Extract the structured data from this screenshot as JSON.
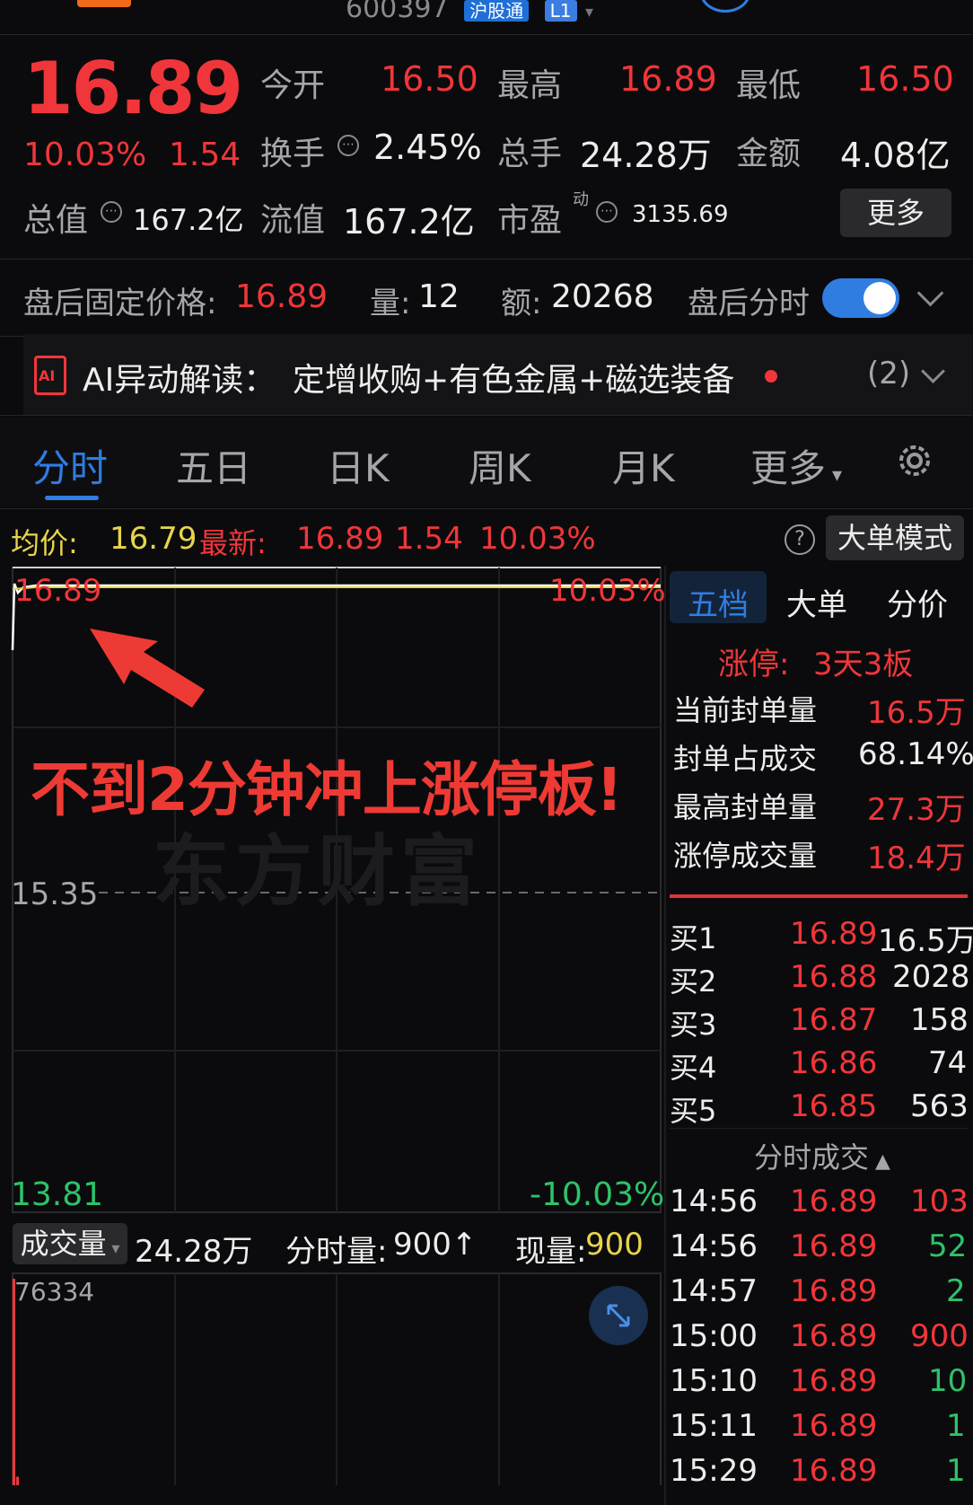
{
  "header": {
    "code": "600397",
    "badges": [
      "沪股通",
      "L1"
    ]
  },
  "quote": {
    "price": "16.89",
    "pct": "10.03%",
    "change": "1.54",
    "row1": [
      {
        "label": "今开",
        "value": "16.50"
      },
      {
        "label": "最高",
        "value": "16.89"
      },
      {
        "label": "最低",
        "value": "16.50"
      }
    ],
    "row2": [
      {
        "label": "换手",
        "value": "2.45%"
      },
      {
        "label": "总手",
        "value": "24.28万"
      },
      {
        "label": "金额",
        "value": "4.08亿"
      }
    ],
    "row3": [
      {
        "label": "总值",
        "value": "167.2亿"
      },
      {
        "label": "流值",
        "value": "167.2亿"
      },
      {
        "label": "市盈",
        "sup": "动",
        "value": "3135.69"
      }
    ],
    "more": "更多"
  },
  "after_hours": {
    "price_label": "盘后固定价格:",
    "price": "16.89",
    "vol_label": "量:",
    "vol": "12",
    "amt_label": "额:",
    "amt": "20268",
    "toggle_label": "盘后分时",
    "toggle_on": true
  },
  "ai": {
    "label": "AI异动解读：",
    "text": "定增收购+有色金属+磁选装备",
    "count": "(2)"
  },
  "tabs": [
    "分时",
    "五日",
    "日K",
    "周K",
    "月K",
    "更多"
  ],
  "active_tab": 0,
  "infobar": {
    "avg_label": "均价:",
    "avg": "16.79",
    "latest_label": "最新:",
    "latest": "16.89",
    "change": "1.54",
    "pct": "10.03%",
    "mode": "大单模式"
  },
  "chart": {
    "top_price": "16.89",
    "top_pct": "10.03%",
    "mid_price": "15.35",
    "bottom_price": "13.81",
    "bottom_pct": "-10.03%",
    "annotation": "不到2分钟冲上涨停板!",
    "watermark": "东方财富"
  },
  "volume_bar": {
    "label": "成交量",
    "total": "24.28万",
    "period_label": "分时量:",
    "period": "900↑",
    "current_label": "现量:",
    "current": "900",
    "max": "76334"
  },
  "volume_data": [
    76334,
    9000,
    2100,
    1500,
    1100,
    900,
    700,
    600,
    500,
    500,
    400,
    400,
    350,
    300,
    300,
    300,
    250,
    250,
    200,
    200
  ],
  "side": {
    "tabs": [
      "五档",
      "大单",
      "分价"
    ],
    "limit_label": "涨停:",
    "limit_value": "3天3板",
    "stats": [
      {
        "label": "当前封单量",
        "value": "16.5万"
      },
      {
        "label": "封单占成交",
        "value": "68.14%"
      },
      {
        "label": "最高封单量",
        "value": "27.3万"
      },
      {
        "label": "涨停成交量",
        "value": "18.4万"
      }
    ],
    "bids": [
      {
        "label": "买1",
        "price": "16.89",
        "vol": "16.5万"
      },
      {
        "label": "买2",
        "price": "16.88",
        "vol": "2028"
      },
      {
        "label": "买3",
        "price": "16.87",
        "vol": "158"
      },
      {
        "label": "买4",
        "price": "16.86",
        "vol": "74"
      },
      {
        "label": "买5",
        "price": "16.85",
        "vol": "563"
      }
    ],
    "trades_title": "分时成交",
    "trades": [
      {
        "time": "14:56",
        "price": "16.89",
        "vol": "103"
      },
      {
        "time": "14:56",
        "price": "16.89",
        "vol": "52"
      },
      {
        "time": "14:57",
        "price": "16.89",
        "vol": "2"
      },
      {
        "time": "15:00",
        "price": "16.89",
        "vol": "900"
      },
      {
        "time": "15:10",
        "price": "16.89",
        "vol": "10"
      },
      {
        "time": "15:11",
        "price": "16.89",
        "vol": "1"
      },
      {
        "time": "15:29",
        "price": "16.89",
        "vol": "1"
      }
    ]
  },
  "colors": {
    "up": "#f0363a",
    "down": "#2ec26a",
    "avg": "#e8d44a",
    "accent": "#2f7de1",
    "bg": "#0b0b0d"
  }
}
